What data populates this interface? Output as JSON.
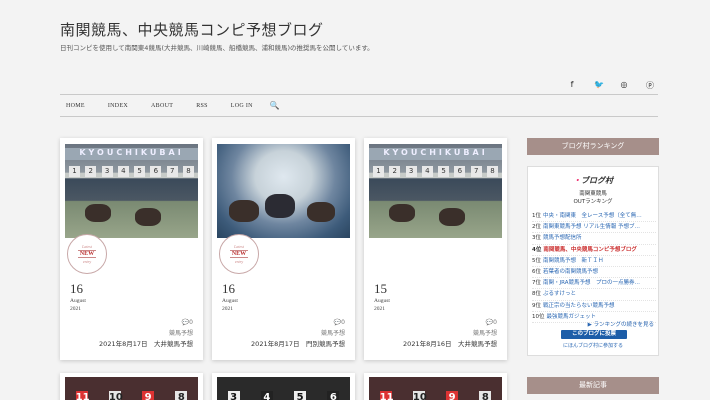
{
  "site": {
    "title": "南関競馬、中央競馬コンピ予想ブログ",
    "description": "日刊コンピを使用して南関東4競馬(大井競馬、川崎競馬、船橋競馬、浦和競馬)の推奨馬を公開しています。"
  },
  "social": [
    "f",
    "🐦",
    "◎",
    "ⓟ"
  ],
  "nav": {
    "items": [
      "HOME",
      "INDEX",
      "ABOUT",
      "RSS",
      "LOG IN"
    ],
    "search_icon": "🔍"
  },
  "posts": [
    {
      "thumb_banner": "KYOUCHIKUBAI",
      "stamp": {
        "top": "Latest",
        "mid": "NEW",
        "bottom": "entry"
      },
      "day": "16",
      "month": "August",
      "year": "2021",
      "comments": "💬0",
      "category": "競馬予想",
      "date_line": "2021年8月17日　大井競馬予想"
    },
    {
      "thumb_banner": "",
      "stamp": {
        "top": "Latest",
        "mid": "NEW",
        "bottom": "entry"
      },
      "day": "16",
      "month": "August",
      "year": "2021",
      "comments": "💬0",
      "category": "競馬予想",
      "date_line": "2021年8月17日　門別競馬予想"
    },
    {
      "thumb_banner": "KYOUCHIKUBAI",
      "day": "15",
      "month": "August",
      "year": "2021",
      "comments": "💬0",
      "category": "競馬予想",
      "date_line": "2021年8月16日　大井競馬予想"
    }
  ],
  "bottom_cards": [
    {
      "digits": [
        "11",
        "10",
        "9",
        "8"
      ]
    },
    {
      "digits": [
        "3",
        "4",
        "5",
        "6"
      ]
    },
    {
      "digits": [
        "11",
        "10",
        "9",
        "8"
      ]
    }
  ],
  "gate_numbers": [
    "1",
    "2",
    "3",
    "4",
    "5",
    "6",
    "7",
    "8"
  ],
  "sidebar": {
    "ranking_header": "ブログ村ランキング",
    "logo_text": "ブログ村",
    "sub1": "南関東競馬",
    "sub2": "OUTランキング",
    "ranking": [
      {
        "pos": "1位",
        "text": "中央・南関東　全レース予想（全て無…"
      },
      {
        "pos": "2位",
        "text": "南関東競馬予想 リアル生情報 予想ブ…"
      },
      {
        "pos": "3位",
        "text": "競馬予想配信所"
      },
      {
        "pos": "4位",
        "text": "南関競馬、中央競馬コンピ予想ブログ",
        "highlight": true
      },
      {
        "pos": "5位",
        "text": "南関競馬予想　新ＴＩＨ"
      },
      {
        "pos": "6位",
        "text": "若葉者の南関競馬予想"
      },
      {
        "pos": "7位",
        "text": "南関・JRA競馬予想　プロの一点勝券…"
      },
      {
        "pos": "8位",
        "text": "ぶるすけっと"
      },
      {
        "pos": "9位",
        "text": "戦正宗の当たらない競馬予想"
      },
      {
        "pos": "10位",
        "text": "最強競馬ガジェット"
      }
    ],
    "more_link": "▶ ランキングの続きを見る",
    "vote_button": "このブログに投票",
    "join_link": "にほんブログ村に参加する",
    "recent_header": "最新記事"
  },
  "colors": {
    "widget_header": "#a68f8a",
    "link": "#2a67b3",
    "vote_button": "#1c5da8"
  }
}
